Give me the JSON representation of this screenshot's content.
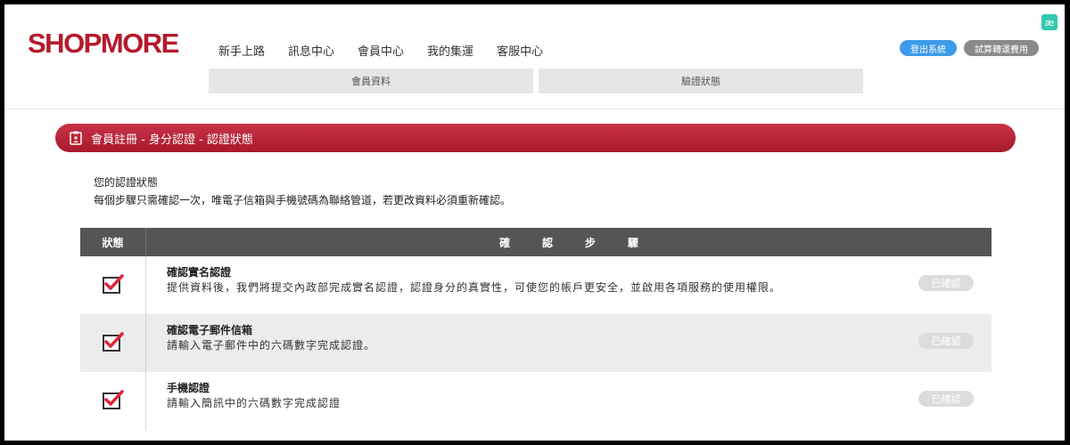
{
  "brand": {
    "logo": "SHOPMORE",
    "accent_color": "#b51a2c"
  },
  "nav": {
    "items": [
      "新手上路",
      "訊息中心",
      "會員中心",
      "我的集運",
      "客服中心"
    ]
  },
  "subtabs": [
    "會員資料",
    "驗證狀態"
  ],
  "header_buttons": {
    "logout": "登出系統",
    "trial": "試算轉運費用"
  },
  "corner_icon": {
    "icon": "ae-extension-icon",
    "glyph": "æ"
  },
  "banner": {
    "icon": "clipboard-icon",
    "title": "會員註冊 - 身分認證 - 認證狀態"
  },
  "intro": {
    "line1": "您的認證狀態",
    "line2": "每個步驟只需確認一次，唯電子信箱與手機號碼為聯絡管道，若更改資料必須重新確認。"
  },
  "table": {
    "headers": {
      "status": "狀態",
      "steps": "確認步驟"
    },
    "rows": [
      {
        "checked": true,
        "title": "確認實名認證",
        "desc": "提供資料後，我們將提交內政部完成實名認證，認證身分的真實性，可使您的帳戶更安全，並啟用各項服務的使用權限。",
        "badge": "已確認"
      },
      {
        "checked": true,
        "title": "確認電子郵件信箱",
        "desc": "請輸入電子郵件中的六碼數字完成認證。",
        "badge": "已確認"
      },
      {
        "checked": true,
        "title": "手機認證",
        "desc": "請輸入簡訊中的六碼數字完成認證",
        "badge": "已確認"
      }
    ]
  }
}
